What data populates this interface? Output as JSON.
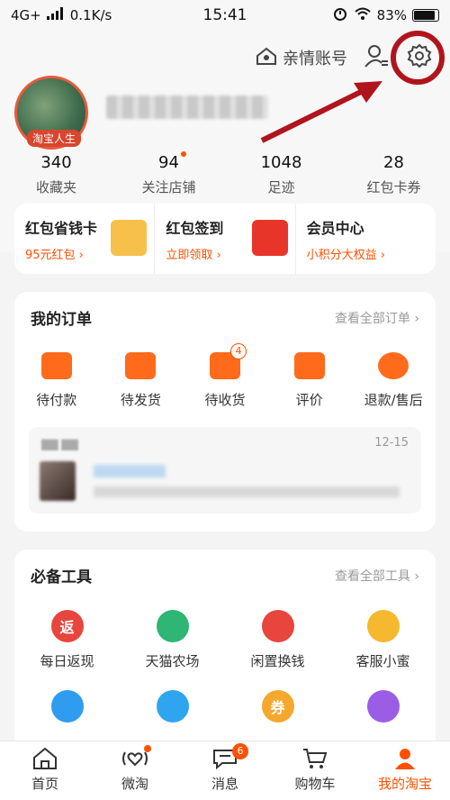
{
  "status_bar": {
    "network": "4G+",
    "speed": "0.1K/s",
    "time": "15:41",
    "battery": "83%"
  },
  "header": {
    "family_account": "亲情账号",
    "avatar_tag": "淘宝人生"
  },
  "stats": [
    {
      "value": "340",
      "label": "收藏夹"
    },
    {
      "value": "94",
      "label": "关注店铺"
    },
    {
      "value": "1048",
      "label": "足迹"
    },
    {
      "value": "28",
      "label": "红包卡券"
    }
  ],
  "promos": [
    {
      "title": "红包省钱卡",
      "sub": "95元红包 ›"
    },
    {
      "title": "红包签到",
      "sub": "立即领取 ›"
    },
    {
      "title": "会员中心",
      "sub": "小积分大权益 ›"
    }
  ],
  "orders": {
    "title": "我的订单",
    "link": "查看全部订单 ›",
    "items": [
      {
        "label": "待付款"
      },
      {
        "label": "待发货"
      },
      {
        "label": "待收货",
        "badge": "4"
      },
      {
        "label": "评价"
      },
      {
        "label": "退款/售后"
      }
    ],
    "logistics_date": "12-15"
  },
  "tools": {
    "title": "必备工具",
    "link": "查看全部工具 ›",
    "items": [
      {
        "label": "每日返现",
        "glyph": "返",
        "color": "#e8453c"
      },
      {
        "label": "天猫农场",
        "glyph": "",
        "color": "#2fb574"
      },
      {
        "label": "闲置换钱",
        "glyph": "",
        "color": "#e8453c"
      },
      {
        "label": "客服小蜜",
        "glyph": "",
        "color": "#f5b82e"
      },
      {
        "label": "",
        "glyph": "",
        "color": "#2f9cf0"
      },
      {
        "label": "",
        "glyph": "",
        "color": "#2fa5f0"
      },
      {
        "label": "",
        "glyph": "券",
        "color": "#f5a82e"
      },
      {
        "label": "",
        "glyph": "",
        "color": "#9b5de5"
      }
    ]
  },
  "tabbar": {
    "items": [
      {
        "label": "首页"
      },
      {
        "label": "微淘"
      },
      {
        "label": "消息",
        "badge": "6"
      },
      {
        "label": "购物车"
      },
      {
        "label": "我的淘宝"
      }
    ]
  },
  "colors": {
    "accent": "#ff5000",
    "highlight": "#b0141c"
  }
}
